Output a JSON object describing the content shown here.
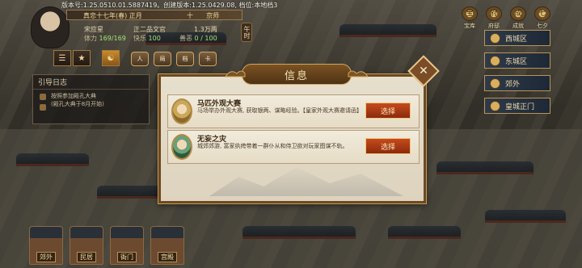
{
  "header": {
    "version_text": "版本号:1.25.0510.01.5887419。创建版本:1.25.0429.08, 档位:本地档3",
    "date": "真忠十七年(春) 正月",
    "term": "十",
    "location": "京师",
    "name": "宋应星",
    "title": "正二品文官",
    "money": "1.3万两",
    "stats": [
      {
        "label": "体力",
        "value": "169/169"
      },
      {
        "label": "快乐",
        "value": "100"
      },
      {
        "label": "善恶",
        "value": "0 / 100"
      }
    ],
    "morning": "午时"
  },
  "toolbar": {
    "buttons": [
      "☰",
      "★",
      "☯"
    ],
    "hex_buttons": [
      "人",
      "局",
      "档",
      "卡"
    ]
  },
  "top_right": [
    {
      "icon": "treasury-icon",
      "label": "宝库"
    },
    {
      "icon": "mansion-icon",
      "label": "府邸"
    },
    {
      "icon": "scroll-icon",
      "label": "成就"
    },
    {
      "icon": "calendar-icon",
      "label": "七夕"
    }
  ],
  "side_nav": [
    "西城区",
    "东城区",
    "郊外",
    "皇城正门"
  ],
  "log": {
    "title": "引导日志",
    "items": [
      "按照参加殿孔大典",
      "(殿孔大典于8月开始)"
    ]
  },
  "bottom_buildings": [
    "郊外",
    "民居",
    "衙门",
    "宫殿"
  ],
  "modal": {
    "title": "信息",
    "close_symbol": "✕",
    "events": [
      {
        "title": "马匹外观大赛",
        "desc": "马场举办外观大赛, 获取银两、谋略经验。【皇家外观大赛邀请函】",
        "button": "选择"
      },
      {
        "title": "无妄之灾",
        "desc": "城郊郊游, 富家纨绔带着一群仆从和侍卫欲对玩家图谋不轨。",
        "button": "选择"
      }
    ]
  }
}
